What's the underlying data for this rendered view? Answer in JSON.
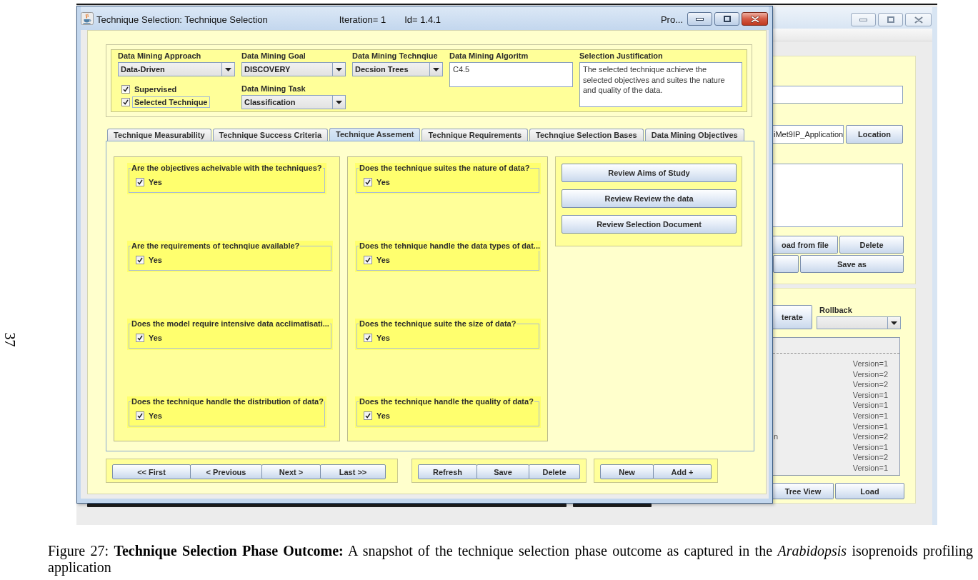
{
  "page_number": "37",
  "front_window": {
    "active": true,
    "title": "Technique Selection: Technique Selection",
    "iteration": "Iteration= 1",
    "id": "Id= 1.4.1",
    "title_right": "Pro...",
    "selection_form": {
      "columns": [
        {
          "fields": [
            {
              "kind": "combo",
              "label": "Data Mining Approach",
              "value": "Data-Driven"
            },
            {
              "kind": "checkbox",
              "label": "Supervised",
              "checked": true,
              "focused": false
            },
            {
              "kind": "checkbox",
              "label": "Selected Technique",
              "checked": true,
              "focused": true
            }
          ]
        },
        {
          "fields": [
            {
              "kind": "combo",
              "label": "Data Mining Goal",
              "value": "DISCOVERY"
            },
            {
              "kind": "combo",
              "label": "Data Mining Task",
              "value": "Classification"
            }
          ]
        },
        {
          "fields": [
            {
              "kind": "combo",
              "label": "Data Mining Technqiue",
              "value": "Decsion Trees"
            }
          ]
        },
        {
          "fields": [
            {
              "kind": "textarea",
              "label": "Data Mining Algoritm",
              "value": "C4.5"
            }
          ]
        },
        {
          "fields": [
            {
              "kind": "textarea",
              "label": "Selection Justification",
              "value": "The selected technique achieve the selected objectives and suites the nature and quality of the data."
            }
          ]
        }
      ]
    },
    "tabs": [
      {
        "label": "Technique Measurability",
        "selected": false
      },
      {
        "label": "Technique Success Criteria",
        "selected": false
      },
      {
        "label": "Technique Assement",
        "selected": true
      },
      {
        "label": "Technique Requirements",
        "selected": false
      },
      {
        "label": "Technqiue Selection Bases",
        "selected": false
      },
      {
        "label": "Data Mining Objectives",
        "selected": false
      }
    ],
    "assessment": {
      "question_columns": [
        {
          "questions": [
            {
              "question": "Are the objectives acheivable with the techniques?",
              "answer": "Yes",
              "checked": true
            },
            {
              "question": "Are the requirements of technqiue available?",
              "answer": "Yes",
              "checked": true
            },
            {
              "question": "Does the model require intensive data acclimatisati...",
              "answer": "Yes",
              "checked": true
            },
            {
              "question": "Does the technique handle the distribution of data?",
              "answer": "Yes",
              "checked": true
            }
          ]
        },
        {
          "questions": [
            {
              "question": "Does the technique suites the nature of data?",
              "answer": "Yes",
              "checked": true
            },
            {
              "question": "Does the tehnique handle the data types of dat...",
              "answer": "Yes",
              "checked": true
            },
            {
              "question": "Does the technique suite the size of data?",
              "answer": "Yes",
              "checked": true
            },
            {
              "question": "Does the technique handle the quality of data?",
              "answer": "Yes",
              "checked": true
            }
          ]
        }
      ],
      "review_buttons": [
        "Review Aims of Study",
        "Review Review the data",
        "Review Selection Document"
      ]
    },
    "button_groups": [
      {
        "buttons": [
          "<< First",
          "< Previous",
          "Next >",
          "Last >>"
        ]
      },
      {
        "buttons": [
          "Refresh",
          "Save",
          "Delete"
        ]
      },
      {
        "buttons": [
          "New",
          "Add +"
        ]
      }
    ]
  },
  "back_window": {
    "active": false,
    "path_field": "iMet9IP_Application",
    "location_button": "Location",
    "file_buttons": [
      "oad from file",
      "Delete"
    ],
    "save_as_button": "Save as",
    "iterate_button": "terate",
    "rollback_label": "Rollback",
    "versions": [
      {
        "version": "Version=1"
      },
      {
        "version": "Version=2"
      },
      {
        "version": "Version=2"
      },
      {
        "version": "Version=1"
      },
      {
        "version": "Version=1"
      },
      {
        "version": "Version=1"
      },
      {
        "version": "Version=1"
      },
      {
        "name": "n",
        "version": "Version=2"
      },
      {
        "version": "Version=1"
      },
      {
        "version": "Version=2"
      },
      {
        "version": "Version=1"
      }
    ],
    "bottom_buttons": [
      "Tree View",
      "Load"
    ]
  },
  "caption": "Figure 27: **Technique Selection Phase Outcome:** A snapshot of the technique selection phase outcome as captured in the *Arabidopsis* isoprenoids profiling application"
}
